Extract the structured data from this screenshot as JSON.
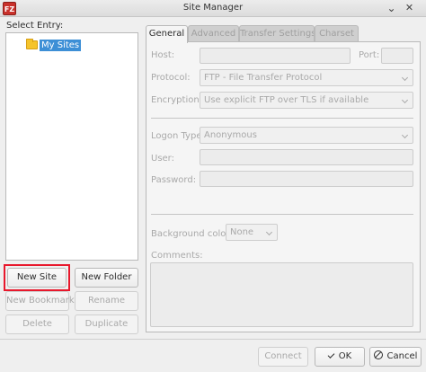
{
  "window": {
    "app_icon_label": "FZ",
    "title": "Site Manager",
    "minimize_glyph": "⌄",
    "close_glyph": "✕"
  },
  "left": {
    "select_entry_label": "Select Entry:",
    "tree": {
      "root_label": "My Sites"
    },
    "buttons": {
      "new_site": "New Site",
      "new_folder": "New Folder",
      "new_bookmark": "New Bookmark",
      "rename": "Rename",
      "delete": "Delete",
      "duplicate": "Duplicate"
    }
  },
  "tabs": [
    {
      "label": "General",
      "active": true
    },
    {
      "label": "Advanced",
      "active": false
    },
    {
      "label": "Transfer Settings",
      "active": false
    },
    {
      "label": "Charset",
      "active": false
    }
  ],
  "general": {
    "host_label": "Host:",
    "host_value": "",
    "port_label": "Port:",
    "port_value": "",
    "protocol_label": "Protocol:",
    "protocol_value": "FTP - File Transfer Protocol",
    "encryption_label": "Encryption:",
    "encryption_value": "Use explicit FTP over TLS if available",
    "logon_type_label": "Logon Type:",
    "logon_type_value": "Anonymous",
    "user_label": "User:",
    "user_value": "",
    "password_label": "Password:",
    "password_value": "",
    "background_color_label": "Background color:",
    "background_color_value": "None",
    "comments_label": "Comments:",
    "comments_value": ""
  },
  "footer": {
    "connect": "Connect",
    "ok": "OK",
    "cancel": "Cancel"
  }
}
